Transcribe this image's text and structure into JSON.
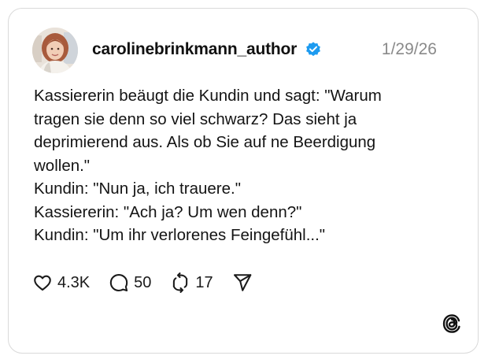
{
  "post": {
    "username": "carolinebrinkmann_author",
    "date": "1/29/26",
    "lines": [
      "Kassiererin beäugt die Kundin und sagt: \"Warum",
      "tragen sie denn so viel schwarz? Das sieht ja",
      "deprimierend aus. Als ob Sie auf ne Beerdigung",
      "wollen.\"",
      "Kundin: \"Nun ja, ich trauere.\"",
      "Kassiererin: \"Ach ja? Um wen denn?\"",
      "Kundin: \"Um ihr verlorenes Feingefühl...\""
    ]
  },
  "actions": {
    "likes": "4.3K",
    "replies": "50",
    "reposts": "17"
  },
  "icons": {
    "verified": "verified-badge-icon",
    "like": "heart-icon",
    "reply": "comment-bubble-icon",
    "repost": "repost-arrows-icon",
    "share": "paper-plane-icon",
    "brand": "threads-logo-icon"
  },
  "colors": {
    "verified_badge": "#1d9bf0",
    "date_text": "#8a8a8a",
    "border": "#d9d9d9"
  }
}
